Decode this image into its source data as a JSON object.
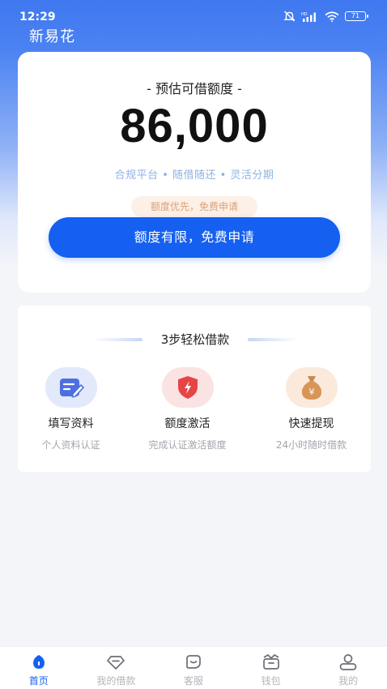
{
  "status_bar": {
    "time": "12:29",
    "network_badge": "HD",
    "battery": "71"
  },
  "app": {
    "title": "新易花"
  },
  "quota": {
    "label": "- 预估可借额度 -",
    "amount": "86,000",
    "features": "合规平台 • 随借随还 • 灵活分期",
    "promo_tag": "额度优先，免费申请",
    "apply_button": "额度有限，免费申请"
  },
  "steps": {
    "title": "3步轻松借款",
    "items": [
      {
        "name": "填写资料",
        "desc": "个人资料认证",
        "icon": "edit-form-icon"
      },
      {
        "name": "额度激活",
        "desc": "完成认证激活额度",
        "icon": "shield-lightning-icon"
      },
      {
        "name": "快速提现",
        "desc": "24小时随时借款",
        "icon": "money-bag-yen-icon"
      }
    ]
  },
  "tabs": [
    {
      "label": "首页",
      "icon": "home-icon",
      "active": true
    },
    {
      "label": "我的借款",
      "icon": "diamond-icon",
      "active": false
    },
    {
      "label": "客服",
      "icon": "chat-icon",
      "active": false
    },
    {
      "label": "钱包",
      "icon": "wallet-icon",
      "active": false
    },
    {
      "label": "我的",
      "icon": "user-icon",
      "active": false
    }
  ],
  "colors": {
    "primary": "#1560f0",
    "header_gradient_top": "#3f78f0",
    "page_bg": "#f4f5f9",
    "tab_inactive": "#b3b5ba"
  }
}
